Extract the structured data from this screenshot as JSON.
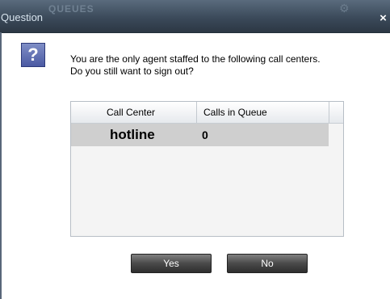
{
  "dialog": {
    "title": "Question",
    "background_title": "QUEUES",
    "close_symbol": "×",
    "icon": "question-mark-icon",
    "message_line1": "You are the only agent staffed to the following call centers.",
    "message_line2": "Do you still want to sign out?"
  },
  "table": {
    "columns": [
      "Call Center",
      "Calls in Queue"
    ],
    "rows": [
      {
        "call_center": "hotline",
        "calls_in_queue": "0"
      }
    ]
  },
  "buttons": {
    "yes_label": "Yes",
    "no_label": "No"
  },
  "colors": {
    "titlebar": "#3b4a5a",
    "button": "#4a4a4a",
    "selected_row": "#cfcfcf",
    "help_icon": "#5b6ab0"
  }
}
